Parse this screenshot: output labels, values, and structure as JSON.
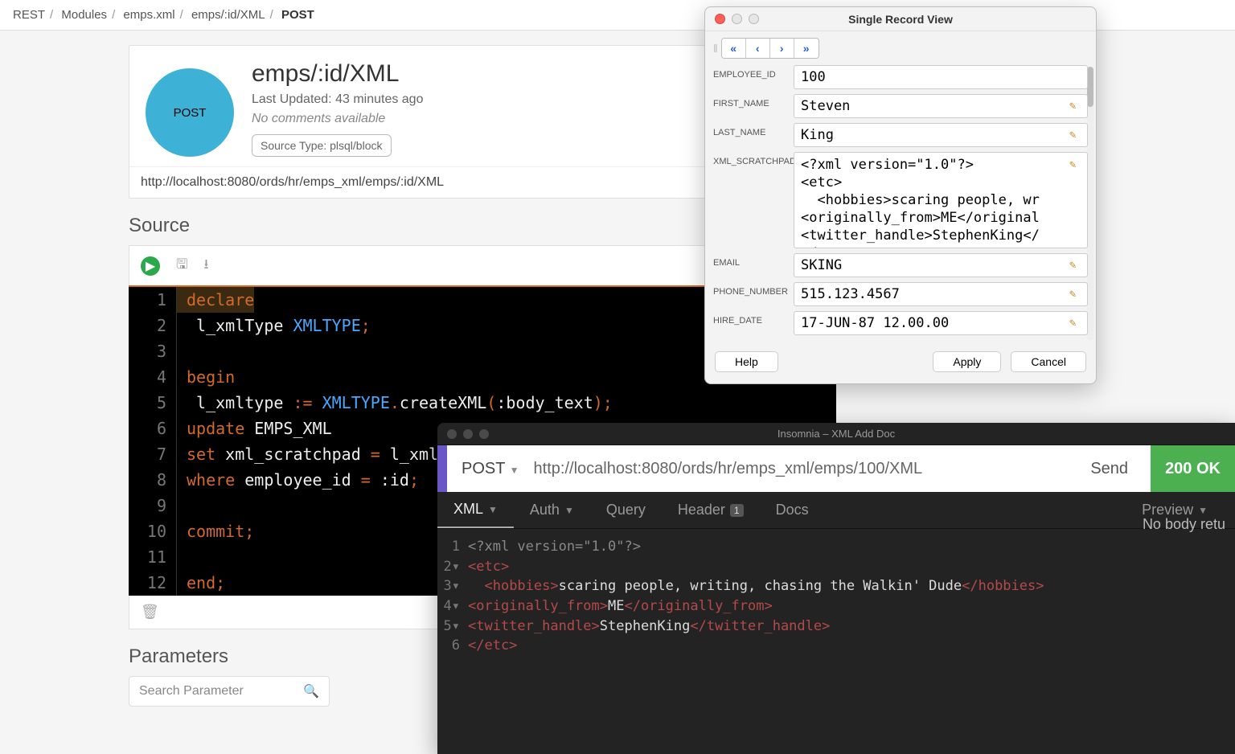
{
  "breadcrumb": [
    "REST",
    "Modules",
    "emps.xml",
    "emps/:id/XML",
    "POST"
  ],
  "card": {
    "title": "emps/:id/XML",
    "updated": "Last Updated: 43 minutes ago",
    "comments": "No comments available",
    "sourceType": "Source Type: plsql/block",
    "method": "POST",
    "url": "http://localhost:8080/ords/hr/emps_xml/emps/:id/XML"
  },
  "sections": {
    "source": "Source",
    "parameters": "Parameters"
  },
  "paramSearchPlaceholder": "Search Parameter",
  "editor": {
    "lines": [
      {
        "n": 1,
        "segs": [
          [
            "kw",
            "declare"
          ]
        ]
      },
      {
        "n": 2,
        "segs": [
          [
            "ident",
            " l_xmlType "
          ],
          [
            "builtin",
            "XMLTYPE"
          ],
          [
            "punct",
            ";"
          ]
        ]
      },
      {
        "n": 3,
        "segs": [
          [
            "ident",
            " "
          ]
        ]
      },
      {
        "n": 4,
        "segs": [
          [
            "kw",
            "begin"
          ]
        ]
      },
      {
        "n": 5,
        "segs": [
          [
            "ident",
            " l_xmltype "
          ],
          [
            "punct",
            ":= "
          ],
          [
            "builtin",
            "XMLTYPE"
          ],
          [
            "dot",
            "."
          ],
          [
            "ident",
            "createXML"
          ],
          [
            "punct",
            "("
          ],
          [
            "ident",
            ":body_text"
          ],
          [
            "punct",
            ");"
          ]
        ]
      },
      {
        "n": 6,
        "segs": [
          [
            "kw",
            "update"
          ],
          [
            "ident",
            " EMPS_XML"
          ]
        ]
      },
      {
        "n": 7,
        "segs": [
          [
            "kw",
            "set"
          ],
          [
            "ident",
            " xml_scratchpad "
          ],
          [
            "punct",
            "="
          ],
          [
            "ident",
            " l_xmltype"
          ]
        ]
      },
      {
        "n": 8,
        "segs": [
          [
            "kw",
            "where"
          ],
          [
            "ident",
            " employee_id "
          ],
          [
            "punct",
            "="
          ],
          [
            "ident",
            " :id"
          ],
          [
            "punct",
            ";"
          ]
        ]
      },
      {
        "n": 9,
        "segs": [
          [
            "ident",
            " "
          ]
        ]
      },
      {
        "n": 10,
        "segs": [
          [
            "kw",
            "commit"
          ],
          [
            "punct",
            ";"
          ]
        ]
      },
      {
        "n": 11,
        "segs": [
          [
            "ident",
            " "
          ]
        ]
      },
      {
        "n": 12,
        "segs": [
          [
            "kw",
            "end"
          ],
          [
            "punct",
            ";"
          ]
        ]
      }
    ]
  },
  "srv": {
    "title": "Single Record View",
    "fields": [
      {
        "label": "EMPLOYEE_ID",
        "value": "100",
        "editable": false
      },
      {
        "label": "FIRST_NAME",
        "value": "Steven",
        "editable": true
      },
      {
        "label": "LAST_NAME",
        "value": "King",
        "editable": true
      },
      {
        "label": "XML_SCRATCHPAD",
        "value": "<?xml version=\"1.0\"?>\n<etc>\n  <hobbies>scaring people, wr\n<originally_from>ME</original\n<twitter_handle>StephenKing</\n</etc>",
        "editable": true,
        "multiline": true
      },
      {
        "label": "EMAIL",
        "value": "SKING",
        "editable": true
      },
      {
        "label": "PHONE_NUMBER",
        "value": "515.123.4567",
        "editable": true
      },
      {
        "label": "HIRE_DATE",
        "value": "17-JUN-87 12.00.00",
        "editable": true
      }
    ],
    "buttons": {
      "help": "Help",
      "apply": "Apply",
      "cancel": "Cancel"
    }
  },
  "ins": {
    "title": "Insomnia – XML Add Doc",
    "method": "POST",
    "url": "http://localhost:8080/ords/hr/emps_xml/emps/100/XML",
    "send": "Send",
    "status": "200 OK",
    "tabs": {
      "xml": "XML",
      "auth": "Auth",
      "query": "Query",
      "header": "Header",
      "headerCount": "1",
      "docs": "Docs",
      "preview": "Preview"
    },
    "response": "No body retu",
    "body": [
      {
        "n": "1",
        "segs": [
          [
            "decl-x",
            "<?xml version=\"1.0\"?>"
          ]
        ]
      },
      {
        "n": "2▾",
        "segs": [
          [
            "tag-x",
            "<etc>"
          ]
        ]
      },
      {
        "n": "3▾",
        "segs": [
          [
            "txt-x",
            "  "
          ],
          [
            "tag-x",
            "<hobbies>"
          ],
          [
            "txt-x",
            "scaring people, writing, chasing the Walkin' Dude"
          ],
          [
            "tag-x",
            "</hobbies>"
          ]
        ]
      },
      {
        "n": "4▾",
        "segs": [
          [
            "tag-x",
            "<originally_from>"
          ],
          [
            "txt-x",
            "ME"
          ],
          [
            "tag-x",
            "</originally_from>"
          ]
        ]
      },
      {
        "n": "5▾",
        "segs": [
          [
            "tag-x",
            "<twitter_handle>"
          ],
          [
            "txt-x",
            "StephenKing"
          ],
          [
            "tag-x",
            "</twitter_handle>"
          ]
        ]
      },
      {
        "n": "6",
        "segs": [
          [
            "tag-x",
            "</etc>"
          ]
        ]
      }
    ]
  },
  "icons": {
    "save": "🖫",
    "download": "⭳",
    "trash": "🗑",
    "search": "🔍",
    "pencil": "✎"
  }
}
